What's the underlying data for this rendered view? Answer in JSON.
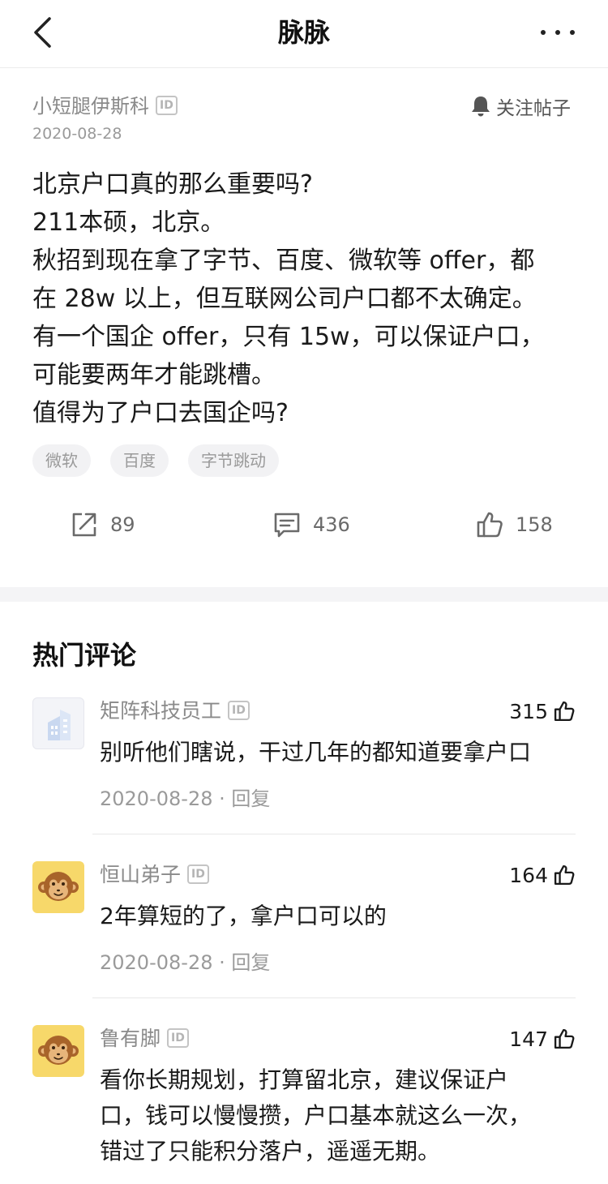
{
  "nav": {
    "title": "脉脉"
  },
  "post": {
    "author": "小短腿伊斯科",
    "id_badge": "ID",
    "date": "2020-08-28",
    "follow_label": "关注帖子",
    "lines": [
      "北京户口真的那么重要吗?",
      "211本硕，北京。",
      "秋招到现在拿了字节、百度、微软等 offer，都",
      "在 28w 以上，但互联网公司户口都不太确定。",
      "有一个国企 offer，只有 15w，可以保证户口，",
      "可能要两年才能跳槽。",
      "值得为了户口去国企吗?"
    ],
    "tags": [
      "微软",
      "百度",
      "字节跳动"
    ],
    "share_count": "89",
    "comment_count": "436",
    "like_count": "158"
  },
  "hot_comments": {
    "title": "热门评论",
    "items": [
      {
        "name": "矩阵科技员工",
        "id_badge": "ID",
        "likes": "315",
        "text_lines": [
          "别听他们瞎说，干过几年的都知道要拿户口"
        ],
        "date": "2020-08-28",
        "reply_label": "回复",
        "avatar": "building-icon"
      },
      {
        "name": "恒山弟子",
        "id_badge": "ID",
        "likes": "164",
        "text_lines": [
          "2年算短的了，拿户口可以的"
        ],
        "date": "2020-08-28",
        "reply_label": "回复",
        "avatar": "monkey-icon"
      },
      {
        "name": "鲁有脚",
        "id_badge": "ID",
        "likes": "147",
        "text_lines": [
          "看你长期规划，打算留北京，建议保证户",
          "口，钱可以慢慢攒，户口基本就这么一次，",
          "错过了只能积分落户，遥遥无期。"
        ],
        "avatar": "monkey-icon"
      }
    ]
  },
  "colors": {
    "text_primary": "#1a1a1a",
    "text_secondary": "#8a8a8a",
    "tag_bg": "#f2f2f4",
    "divider": "#f4f4f6",
    "avatar_yellow": "#f7d86a"
  }
}
